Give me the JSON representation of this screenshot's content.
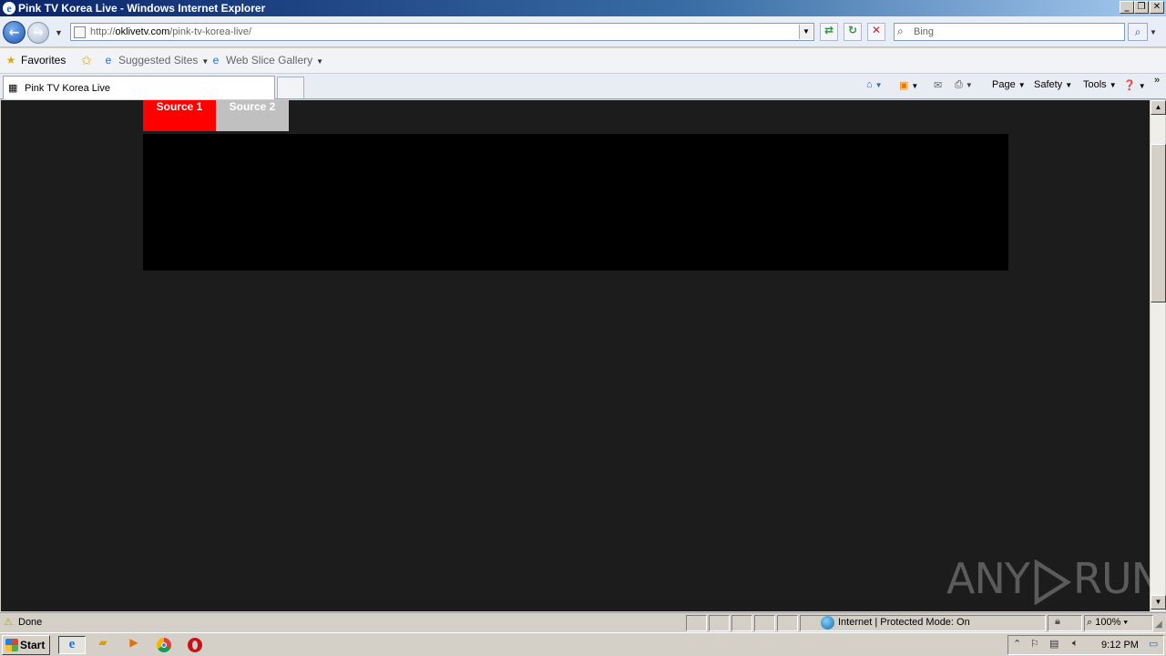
{
  "window": {
    "title": "Pink TV Korea Live - Windows Internet Explorer"
  },
  "navigation": {
    "url_prefix": "http://",
    "url_domain": "oklivetv.com",
    "url_path": "/pink-tv-korea-live/",
    "search_placeholder": "Bing"
  },
  "favorites_bar": {
    "favorites_label": "Favorites",
    "items": [
      {
        "label": "Suggested Sites"
      },
      {
        "label": "Web Slice Gallery"
      }
    ]
  },
  "tabs": [
    {
      "label": "Pink TV Korea Live"
    }
  ],
  "command_bar": {
    "page_label": "Page",
    "safety_label": "Safety",
    "tools_label": "Tools"
  },
  "page": {
    "source_tabs": [
      {
        "label": "Source 1",
        "active": true,
        "color": "#ff0000"
      },
      {
        "label": "Source 2",
        "active": false,
        "color": "#c0c0c0"
      }
    ],
    "watermark_left": "ANY",
    "watermark_right": "RUN"
  },
  "status_bar": {
    "status": "Done",
    "zone": "Internet | Protected Mode: On",
    "zoom": "100%"
  },
  "taskbar": {
    "start_label": "Start",
    "clock": "9:12 PM"
  }
}
